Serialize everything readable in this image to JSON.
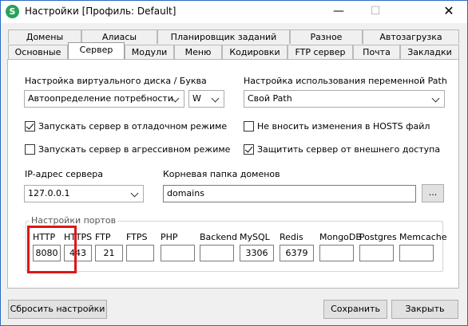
{
  "window": {
    "title": "Настройки [Профиль: Default]",
    "app_icon_letter": "S",
    "minimize_glyph": "—",
    "maximize_glyph": "☐",
    "close_glyph": "✕"
  },
  "tabs_row1": [
    "Домены",
    "Алиасы",
    "Планировщик заданий",
    "Разное",
    "Автозагрузка"
  ],
  "tabs_row2": [
    "Основные",
    "Сервер",
    "Модули",
    "Меню",
    "Кодировки",
    "FTP сервер",
    "Почта",
    "Закладки"
  ],
  "active_tab": "Сервер",
  "virtual_disk": {
    "label": "Настройка виртуального диска / Буква",
    "mode_value": "Автоопределение потребности",
    "letter_value": "W"
  },
  "path_var": {
    "label": "Настройка использования переменной Path",
    "value": "Свой Path"
  },
  "checkboxes": [
    {
      "label": "Запускать сервер в отладочном режиме",
      "checked": true
    },
    {
      "label": "Запускать сервер в агрессивном режиме",
      "checked": false
    },
    {
      "label": "Не вносить изменения в HOSTS файл",
      "checked": false
    },
    {
      "label": "Защитить сервер от внешнего доступа",
      "checked": true
    }
  ],
  "ip": {
    "label": "IP-адрес сервера",
    "value": "127.0.0.1"
  },
  "domains_folder": {
    "label": "Корневая папка доменов",
    "value": "domains",
    "browse_label": "..."
  },
  "ports": {
    "group_title": "Настройки портов",
    "labels": [
      "HTTP",
      "HTTPS",
      "FTP",
      "FTPS",
      "PHP",
      "Backend",
      "MySQL",
      "Redis",
      "MongoDB",
      "Postgres",
      "Memcache"
    ],
    "values": [
      "8080",
      "443",
      "21",
      "",
      "",
      "",
      "3306",
      "6379",
      "",
      "",
      ""
    ]
  },
  "buttons": {
    "reset": "Сбросить настройки",
    "save": "Сохранить",
    "close": "Закрыть"
  },
  "colors": {
    "highlight": "#e01515",
    "app_icon": "#27a35a",
    "window_border": "#2b6bbf"
  }
}
